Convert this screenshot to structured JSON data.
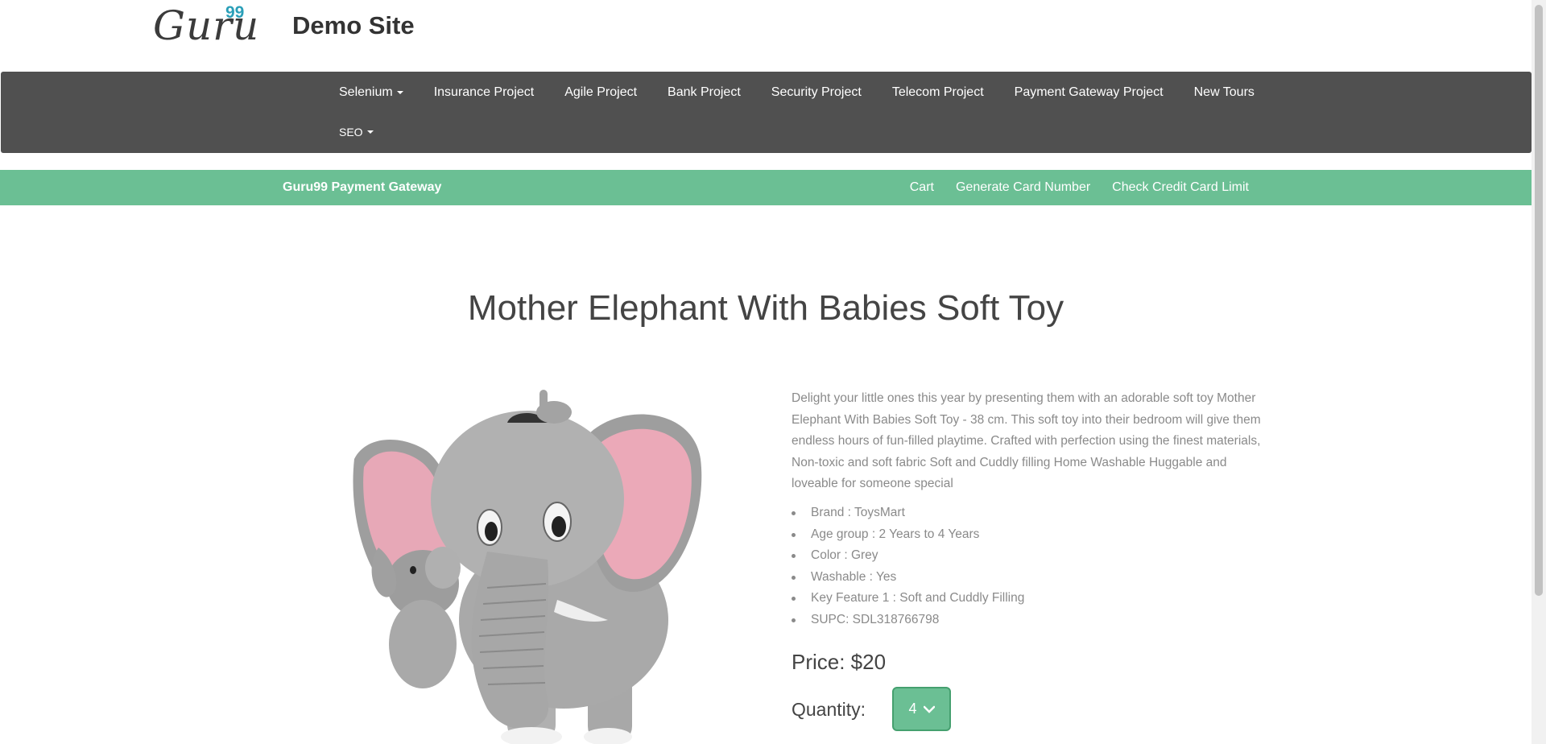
{
  "header": {
    "logo_text": "Guru",
    "logo_sup": "99",
    "site_title": "Demo Site"
  },
  "navbar": {
    "items": [
      {
        "label": "Selenium",
        "dropdown": true
      },
      {
        "label": "Insurance Project"
      },
      {
        "label": "Agile Project"
      },
      {
        "label": "Bank Project"
      },
      {
        "label": "Security Project"
      },
      {
        "label": "Telecom Project"
      },
      {
        "label": "Payment Gateway Project"
      },
      {
        "label": "New Tours"
      },
      {
        "label": "SEO",
        "dropdown": true
      }
    ]
  },
  "subnav": {
    "brand": "Guru99 Payment Gateway",
    "links": [
      "Cart",
      "Generate Card Number",
      "Check Credit Card Limit"
    ]
  },
  "product": {
    "title": "Mother Elephant With Babies Soft Toy",
    "description": "Delight your little ones this year by presenting them with an adorable soft toy Mother Elephant With Babies Soft Toy - 38 cm. This soft toy into their bedroom will give them endless hours of fun-filled playtime. Crafted with perfection using the finest materials, Non-toxic and soft fabric Soft and Cuddly filling Home Washable Huggable and loveable for someone special",
    "features": [
      "Brand : ToysMart",
      "Age group : 2 Years to 4 Years",
      "Color : Grey",
      "Washable : Yes",
      "Key Feature 1 : Soft and Cuddly Filling",
      "SUPC: SDL318766798"
    ],
    "price": "Price: $20",
    "quantity_label": "Quantity:",
    "quantity_value": "4"
  },
  "colors": {
    "navbar": "#505050",
    "subnav": "#6bbf94",
    "logo_accent": "#2a9fb8"
  },
  "icons": {
    "dropdown": "caret-down-icon",
    "select": "chevron-down-icon"
  }
}
